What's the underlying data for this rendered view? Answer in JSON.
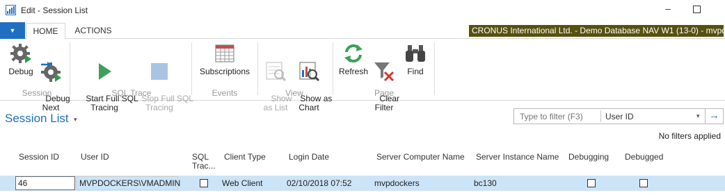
{
  "window": {
    "title": "Edit - Session List",
    "minimize_glyph": "–"
  },
  "ribbon": {
    "app_button_glyph": "▼",
    "tabs": [
      {
        "label": "HOME",
        "active": true
      },
      {
        "label": "ACTIONS",
        "active": false
      }
    ],
    "company_banner": "CRONUS International Ltd. - Demo Database NAV W1 (13-0) - mvpd",
    "groups": [
      {
        "label": "Session",
        "buttons": [
          {
            "label": "Debug",
            "icon": "gear-debug-icon",
            "enabled": true
          },
          {
            "label": "Debug\nNext",
            "icon": "gear-debug-next-icon",
            "enabled": true
          }
        ]
      },
      {
        "label": "SQL Trace",
        "buttons": [
          {
            "label": "Start Full SQL\nTracing",
            "icon": "play-icon",
            "enabled": true
          },
          {
            "label": "Stop Full SQL\nTracing",
            "icon": "stop-icon",
            "enabled": false
          }
        ]
      },
      {
        "label": "Events",
        "buttons": [
          {
            "label": "Subscriptions",
            "icon": "grid-icon",
            "enabled": true
          }
        ]
      },
      {
        "label": "View",
        "buttons": [
          {
            "label": "Show\nas List",
            "icon": "list-search-icon",
            "enabled": false
          },
          {
            "label": "Show as\nChart",
            "icon": "chart-search-icon",
            "enabled": true
          }
        ]
      },
      {
        "label": "Page",
        "buttons": [
          {
            "label": "Refresh",
            "icon": "refresh-icon",
            "enabled": true
          },
          {
            "label": "Clear\nFilter",
            "icon": "clear-filter-icon",
            "enabled": true
          },
          {
            "label": "Find",
            "icon": "binoculars-icon",
            "enabled": true
          }
        ]
      }
    ]
  },
  "page": {
    "title": "Session List",
    "title_caret": "▾"
  },
  "filter": {
    "placeholder": "Type to filter (F3)",
    "field": "User ID",
    "field_caret": "▾",
    "go_glyph": "→",
    "status": "No filters applied"
  },
  "table": {
    "columns": [
      "Session ID",
      "User ID",
      "SQL\nTrac...",
      "Client Type",
      "Login Date",
      "Server Computer Name",
      "Server Instance Name",
      "Debugging",
      "Debugged"
    ],
    "rows": [
      {
        "session_id": "46",
        "user_id": "MVPDOCKERS\\VMADMIN",
        "sql_tracing": false,
        "client_type": "Web Client",
        "login_date": "02/10/2018 07:52",
        "server_computer_name": "mvpdockers",
        "server_instance_name": "bc130",
        "debugging": false,
        "debugged": false
      }
    ]
  },
  "colors": {
    "accent": "#1e6fc2",
    "banner": "#56510f",
    "selected_row": "#cce4f7",
    "page_title": "#1f6fb5"
  }
}
